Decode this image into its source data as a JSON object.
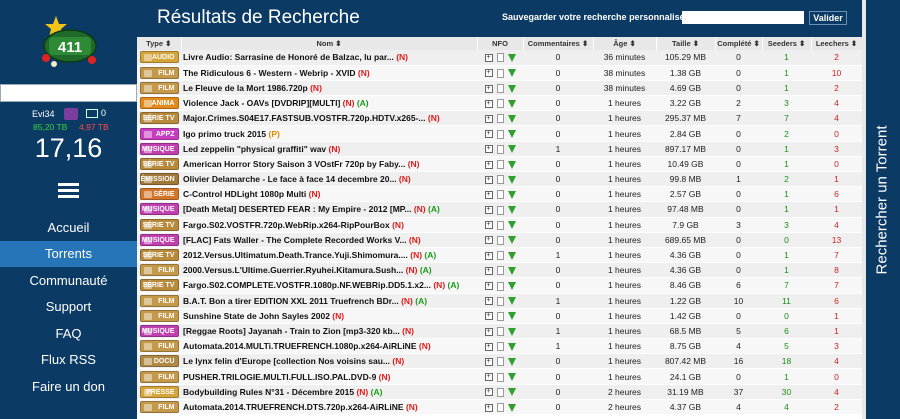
{
  "sidebar": {
    "user": {
      "name": "Evi34",
      "mail_count": "0",
      "uploaded": "85,20 TB",
      "downloaded": "4,97 TB",
      "ratio": "17,16"
    },
    "nav": [
      "Accueil",
      "Torrents",
      "Communauté",
      "Support",
      "FAQ",
      "Flux RSS",
      "Faire un don"
    ],
    "active_nav": "Torrents",
    "logo_text": "411"
  },
  "header": {
    "title": "Résultats de Recherche",
    "save_label": "Sauvegarder votre recherche personnalisée",
    "save_input_value": "",
    "save_button": "Valider"
  },
  "right_bar": {
    "label": "Rechercher un Torrent"
  },
  "table": {
    "columns": [
      "Type",
      "Nom",
      "NFO",
      "Commentaires",
      "Âge",
      "Taille",
      "Complété",
      "Seeders",
      "Leechers"
    ],
    "rows": [
      {
        "type": "AUDIO",
        "color": "#d4a53a",
        "name": "Livre Audio: Sarrasine de Honoré de Balzac, lu par...",
        "tags": [
          {
            "t": "(N)",
            "c": "n"
          }
        ],
        "comments": "0",
        "age": "36 minutes",
        "size": "105.29 MB",
        "completed": "0",
        "seeders": "1",
        "leechers": "2"
      },
      {
        "type": "FILM",
        "color": "#c49a4a",
        "name": "The Ridiculous 6 - Western - Webrip - XVID",
        "tags": [
          {
            "t": "(N)",
            "c": "n"
          }
        ],
        "comments": "0",
        "age": "38 minutes",
        "size": "1.38 GB",
        "completed": "0",
        "seeders": "1",
        "leechers": "10"
      },
      {
        "type": "FILM",
        "color": "#c49a4a",
        "name": "Le Fleuve de la Mort 1986.720p",
        "tags": [
          {
            "t": "(N)",
            "c": "n"
          }
        ],
        "comments": "0",
        "age": "38 minutes",
        "size": "4.69 GB",
        "completed": "0",
        "seeders": "1",
        "leechers": "2"
      },
      {
        "type": "ANIMA",
        "color": "#e38a1c",
        "name": "Violence Jack - OAVs [DVDRIP][MULTI]",
        "tags": [
          {
            "t": "(N)",
            "c": "n"
          },
          {
            "t": "(A)",
            "c": "a"
          }
        ],
        "comments": "0",
        "age": "1 heures",
        "size": "3.22 GB",
        "completed": "2",
        "seeders": "3",
        "leechers": "4"
      },
      {
        "type": "SÉRIE TV",
        "color": "#b78a3c",
        "name": "Major.Crimes.S04E17.FASTSUB.VOSTFR.720p.HDTV.x265-...",
        "tags": [
          {
            "t": "(N)",
            "c": "n"
          }
        ],
        "comments": "0",
        "age": "1 heures",
        "size": "295.37 MB",
        "completed": "7",
        "seeders": "7",
        "leechers": "4"
      },
      {
        "type": "APPZ",
        "color": "#c83cc0",
        "name": "Igo primo truck 2015",
        "tags": [
          {
            "t": "(P)",
            "c": "p"
          }
        ],
        "comments": "0",
        "age": "1 heures",
        "size": "2.84 GB",
        "completed": "0",
        "seeders": "2",
        "leechers": "0"
      },
      {
        "type": "MUSIQUE",
        "color": "#c040b0",
        "name": "Led zeppelin \"physical graffiti\" wav",
        "tags": [
          {
            "t": "(N)",
            "c": "n"
          }
        ],
        "comments": "1",
        "age": "1 heures",
        "size": "897.17 MB",
        "completed": "0",
        "seeders": "1",
        "leechers": "3"
      },
      {
        "type": "SÉRIE TV",
        "color": "#b78a3c",
        "name": "American Horror Story Saison 3 VOstFr 720p by Faby...",
        "tags": [
          {
            "t": "(N)",
            "c": "n"
          }
        ],
        "comments": "0",
        "age": "1 heures",
        "size": "10.49 GB",
        "completed": "0",
        "seeders": "1",
        "leechers": "0"
      },
      {
        "type": "ÉMISSION",
        "color": "#a07838",
        "name": "Olivier Delamarche - Le face à face 14 decembre 20...",
        "tags": [
          {
            "t": "(N)",
            "c": "n"
          }
        ],
        "comments": "0",
        "age": "1 heures",
        "size": "99.8 MB",
        "completed": "1",
        "seeders": "2",
        "leechers": "1"
      },
      {
        "type": "SÉRIE",
        "color": "#d4762a",
        "name": "C-Control HDLight 1080p Multi",
        "tags": [
          {
            "t": "(N)",
            "c": "n"
          }
        ],
        "comments": "0",
        "age": "1 heures",
        "size": "2.57 GB",
        "completed": "0",
        "seeders": "1",
        "leechers": "6"
      },
      {
        "type": "MUSIQUE",
        "color": "#c040b0",
        "name": "[Death Metal] DESERTED FEAR : My Empire - 2012 [MP...",
        "tags": [
          {
            "t": "(N)",
            "c": "n"
          },
          {
            "t": "(A)",
            "c": "a"
          }
        ],
        "comments": "0",
        "age": "1 heures",
        "size": "97.48 MB",
        "completed": "0",
        "seeders": "1",
        "leechers": "1"
      },
      {
        "type": "SÉRIE TV",
        "color": "#b78a3c",
        "name": "Fargo.S02.VOSTFR.720p.WebRip.x264-RipPourBox",
        "tags": [
          {
            "t": "(N)",
            "c": "n"
          }
        ],
        "comments": "0",
        "age": "1 heures",
        "size": "7.9 GB",
        "completed": "3",
        "seeders": "3",
        "leechers": "4"
      },
      {
        "type": "MUSIQUE",
        "color": "#c040b0",
        "name": "[FLAC] Fats Waller - The Complete Recorded Works V...",
        "tags": [
          {
            "t": "(N)",
            "c": "n"
          }
        ],
        "comments": "0",
        "age": "1 heures",
        "size": "689.65 MB",
        "completed": "0",
        "seeders": "0",
        "leechers": "13"
      },
      {
        "type": "SÉRIE TV",
        "color": "#b78a3c",
        "name": "2012.Versus.Ultimatum.Death.Trance.Yuji.Shimomura....",
        "tags": [
          {
            "t": "(N)",
            "c": "n"
          },
          {
            "t": "(A)",
            "c": "a"
          }
        ],
        "comments": "1",
        "age": "1 heures",
        "size": "4.36 GB",
        "completed": "0",
        "seeders": "1",
        "leechers": "7"
      },
      {
        "type": "FILM",
        "color": "#c49a4a",
        "name": "2000.Versus.L'Ultime.Guerrier.Ryuhei.Kitamura.Sush...",
        "tags": [
          {
            "t": "(N)",
            "c": "n"
          },
          {
            "t": "(A)",
            "c": "a"
          }
        ],
        "comments": "0",
        "age": "1 heures",
        "size": "4.36 GB",
        "completed": "0",
        "seeders": "1",
        "leechers": "8"
      },
      {
        "type": "SÉRIE TV",
        "color": "#b78a3c",
        "name": "Fargo.S02.COMPLETE.VOSTFR.1080p.NF.WEBRip.DD5.1.x2...",
        "tags": [
          {
            "t": "(N)",
            "c": "n"
          },
          {
            "t": "(A)",
            "c": "a"
          }
        ],
        "comments": "0",
        "age": "1 heures",
        "size": "8.46 GB",
        "completed": "6",
        "seeders": "7",
        "leechers": "7"
      },
      {
        "type": "FILM",
        "color": "#c49a4a",
        "name": "B.A.T. Bon a tirer EDITION XXL 2011 Truefrench BDr...",
        "tags": [
          {
            "t": "(N)",
            "c": "n"
          },
          {
            "t": "(A)",
            "c": "a"
          }
        ],
        "comments": "1",
        "age": "1 heures",
        "size": "1.22 GB",
        "completed": "10",
        "seeders": "11",
        "leechers": "6"
      },
      {
        "type": "FILM",
        "color": "#c49a4a",
        "name": "Sunshine State de John Sayles 2002",
        "tags": [
          {
            "t": "(N)",
            "c": "n"
          }
        ],
        "comments": "0",
        "age": "1 heures",
        "size": "1.42 GB",
        "completed": "0",
        "seeders": "0",
        "leechers": "1"
      },
      {
        "type": "MUSIQUE",
        "color": "#c040b0",
        "name": "[Reggae Roots] Jayanah - Train to Zion [mp3-320 kb...",
        "tags": [
          {
            "t": "(N)",
            "c": "n"
          }
        ],
        "comments": "1",
        "age": "1 heures",
        "size": "68.5 MB",
        "completed": "5",
        "seeders": "6",
        "leechers": "1"
      },
      {
        "type": "FILM",
        "color": "#c49a4a",
        "name": "Automata.2014.MULTi.TRUEFRENCH.1080p.x264-AiRLiNE",
        "tags": [
          {
            "t": "(N)",
            "c": "n"
          }
        ],
        "comments": "1",
        "age": "1 heures",
        "size": "8.75 GB",
        "completed": "4",
        "seeders": "5",
        "leechers": "3"
      },
      {
        "type": "DOCU",
        "color": "#b08a44",
        "name": "Le lynx felin d'Europe [collection Nos voisins sau...",
        "tags": [
          {
            "t": "(N)",
            "c": "n"
          }
        ],
        "comments": "0",
        "age": "1 heures",
        "size": "807.42 MB",
        "completed": "16",
        "seeders": "18",
        "leechers": "4"
      },
      {
        "type": "FILM",
        "color": "#c49a4a",
        "name": "PUSHER.TRILOGIE.MULTI.FULL.ISO.PAL.DVD-9",
        "tags": [
          {
            "t": "(N)",
            "c": "n"
          }
        ],
        "comments": "0",
        "age": "1 heures",
        "size": "24.1 GB",
        "completed": "0",
        "seeders": "1",
        "leechers": "0"
      },
      {
        "type": "PRESSE",
        "color": "#d4a53a",
        "name": "Bodybuilding Rules N°31 - Décembre 2015",
        "tags": [
          {
            "t": "(N)",
            "c": "n"
          },
          {
            "t": "(A)",
            "c": "a"
          }
        ],
        "comments": "0",
        "age": "2 heures",
        "size": "31.19 MB",
        "completed": "37",
        "seeders": "30",
        "leechers": "4"
      },
      {
        "type": "FILM",
        "color": "#c49a4a",
        "name": "Automata.2014.TRUEFRENCH.DTS.720p.x264-AiRLiNE",
        "tags": [
          {
            "t": "(N)",
            "c": "n"
          }
        ],
        "comments": "0",
        "age": "2 heures",
        "size": "4.37 GB",
        "completed": "4",
        "seeders": "4",
        "leechers": "2"
      }
    ]
  },
  "colors": {
    "navy": "#0b3a64",
    "active_nav": "#2575b8",
    "seeders": "#1a8f1a",
    "leechers": "#d12222"
  }
}
